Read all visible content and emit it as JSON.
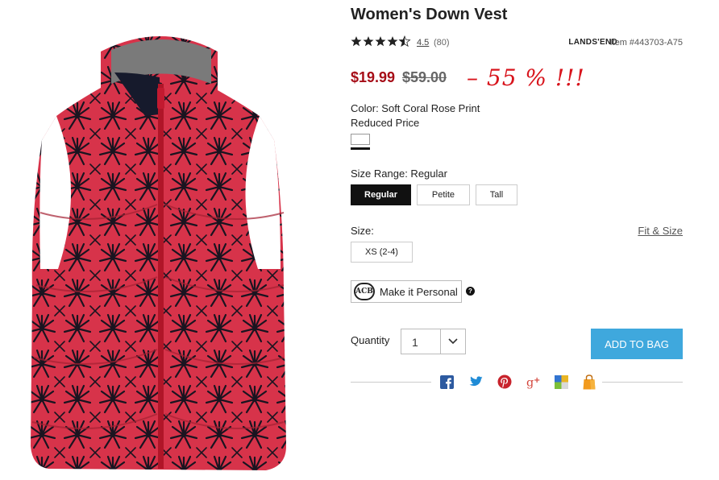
{
  "product": {
    "title": "Women's Down Vest",
    "image_alt": "red floral print down vest"
  },
  "rating": {
    "value": "4.5",
    "count": "(80)",
    "stars": 4.5
  },
  "brand": "LANDS'END",
  "item_number": "Item #443703-A75",
  "price": {
    "sale": "$19.99",
    "original": "$59.00",
    "discount_note": "– 55 % !!!"
  },
  "color": {
    "label": "Color: Soft Coral Rose Print",
    "sub_label": "Reduced Price"
  },
  "size_range": {
    "label": "Size Range: Regular",
    "options": [
      "Regular",
      "Petite",
      "Tall"
    ],
    "selected": "Regular"
  },
  "size": {
    "label": "Size:",
    "fit_link": "Fit & Size",
    "options": [
      "XS (2-4)"
    ]
  },
  "personalize": {
    "monogram": "ACB",
    "label": "Make it Personal",
    "help": "?"
  },
  "quantity": {
    "label": "Quantity",
    "value": "1"
  },
  "add_to_bag": "ADD TO BAG",
  "share_icons": [
    "facebook-icon",
    "twitter-icon",
    "pinterest-icon",
    "google-plus-icon",
    "delicious-icon",
    "shopping-bag-icon"
  ],
  "colors": {
    "sale_red": "#a60d17",
    "accent_blue": "#3fa8dd",
    "vest_red": "#d7334a"
  }
}
